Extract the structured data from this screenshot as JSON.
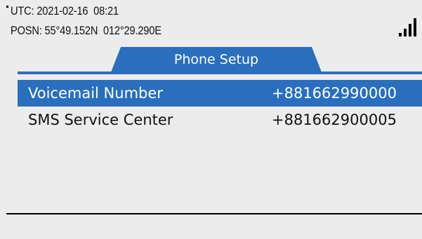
{
  "status": {
    "utc_label": "UTC:",
    "utc_value": "2021-02-16  08:21",
    "posn_label": "POSN:",
    "posn_value": "55°49.152N  012°29.290E",
    "signal_bars_shown": 4
  },
  "tab": {
    "title": "Phone Setup"
  },
  "list": {
    "rows": [
      {
        "label": "Voicemail Number",
        "value": "+881662990000",
        "selected": true
      },
      {
        "label": "SMS Service Center",
        "value": "+881662900005",
        "selected": false
      }
    ]
  },
  "colors": {
    "accent": "#2a6fbe",
    "background": "#ececec",
    "text": "#111111"
  },
  "icons": {
    "signal": "signal-strength-icon"
  }
}
